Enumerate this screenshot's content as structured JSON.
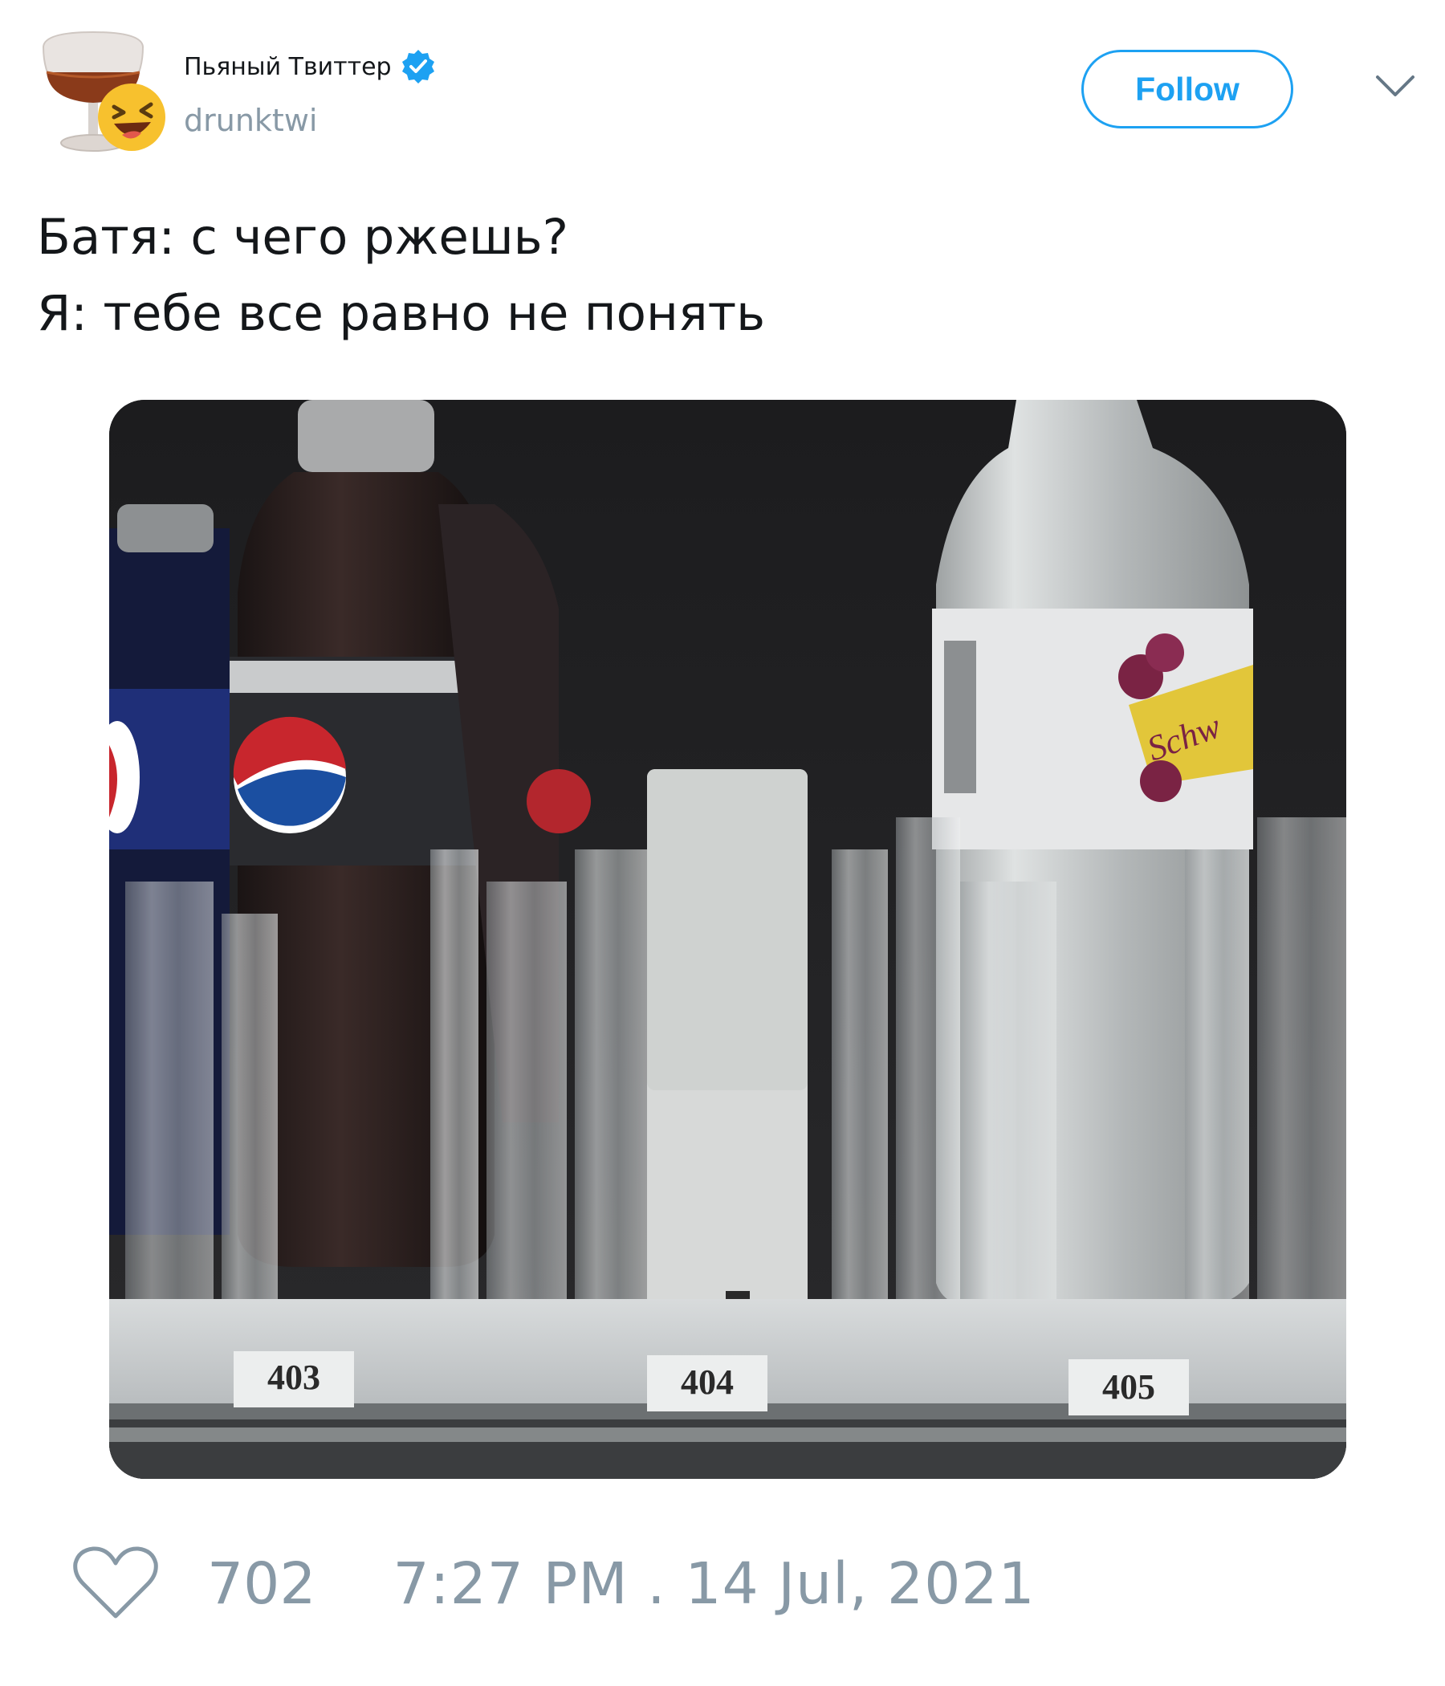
{
  "author": {
    "display_name": "Пьяный Твиттер",
    "handle": "drunktwi",
    "verified": true,
    "avatar_icon": "cognac-glass-laughing-emoji-icon"
  },
  "header": {
    "follow_label": "Follow",
    "menu_icon": "chevron-down-icon"
  },
  "tweet": {
    "lines": [
      "Батя: с чего ржешь?",
      "Я: тебе все равно не понять"
    ]
  },
  "media": {
    "slot_labels": [
      "403",
      "404",
      "405"
    ],
    "bottle_brand_text": "Schw"
  },
  "footer": {
    "like_icon": "heart-icon",
    "like_count": "702",
    "timestamp": "7:27 PM . 14 Jul, 2021"
  },
  "colors": {
    "accent": "#1da1f2",
    "muted": "#8899a6",
    "text": "#14171a"
  }
}
